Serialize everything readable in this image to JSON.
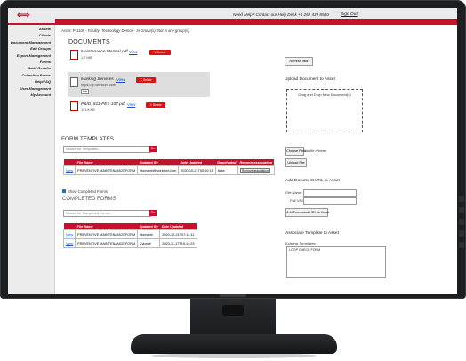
{
  "header": {
    "logo_glyph": "⟺",
    "help_text": "Need Help? Contact our Help Desk +1 262 439 8580",
    "sign_out": "Sign Out"
  },
  "sidebar": {
    "items": [
      "Assets",
      "Clients",
      "Document Management",
      "Edit Groups",
      "Export Management",
      "Forms",
      "Audit Results",
      "Collection Forms",
      "Help/FAQ",
      "User Management",
      "My Account"
    ]
  },
  "breadcrumb": "Asset: P-1108 - Facility: Technology Demos - In Group(s): Not in any group(s)",
  "documents": {
    "heading": "DOCUMENTS",
    "items": [
      {
        "name": "Maintenance Manual.pdf",
        "size": "1.7 MB",
        "view": "View",
        "delete": "X Delete",
        "icon": "pdf-icon"
      },
      {
        "name": "Marking Services",
        "url": "https://xp.worktunr.com",
        "link_badge": "link",
        "view": "View",
        "delete": "X Delete",
        "icon": "web-link-icon"
      },
      {
        "name": "P&ID_811-PE1-107.pdf",
        "size": "121.8 KB",
        "view": "View",
        "delete": "X Delete",
        "icon": "pdf-icon"
      }
    ]
  },
  "form_templates": {
    "heading": "FORM TEMPLATES",
    "search_placeholder": "Search for Templates...",
    "go_label": "Go",
    "columns": [
      "",
      "File Name",
      "Updated By",
      "Date Updated",
      "Deactivated",
      "Remove association"
    ],
    "rows": [
      {
        "view": "View",
        "file": "PREVENTIVE MAINTENANCE FORM",
        "updated_by": "stomabb@worktunr.com",
        "date": "2020-10-21T05:00:15",
        "deactivated": "false",
        "remove": "Remove association"
      }
    ]
  },
  "completed_forms": {
    "show_label": "Show Completed Forms",
    "heading": "COMPLETED FORMS",
    "search_placeholder": "Search for Completed Forms...",
    "go_label": "Go",
    "columns": [
      "",
      "File Name",
      "Updated By",
      "Date Updated"
    ],
    "rows": [
      {
        "view": "View",
        "file": "PREVENTIVE MAINTENANCE FORM",
        "updated_by": "stomabb",
        "date": "2020-10-21T07:14:11"
      },
      {
        "view": "View",
        "file": "PREVENTIVE MAINTENANCE FORM",
        "updated_by": "Zvlogof",
        "date": "2020-11-17T15:14:23"
      }
    ]
  },
  "right_panel": {
    "refresh_label": "Refresh lists",
    "upload_heading": "Upload Document to Asset",
    "dropzone_text": "Drag and Drop New Document(s)",
    "choose_file": "Choose Files",
    "no_file": "No file chosen",
    "upload_button": "Upload File",
    "add_url_heading": "Add Document URL to Asset",
    "file_name_label": "File Name:",
    "full_url_label": "Full URL:",
    "add_url_button": "Add Document URL to Asset",
    "assoc_heading": "Associate Template to Asset",
    "existing_label": "Existing Templates:",
    "templates": [
      "LOOP CHECK FORM"
    ]
  },
  "colors": {
    "brand_red": "#c8102e",
    "link_blue": "#1a4fd6",
    "bezel": "#1d1e20"
  }
}
